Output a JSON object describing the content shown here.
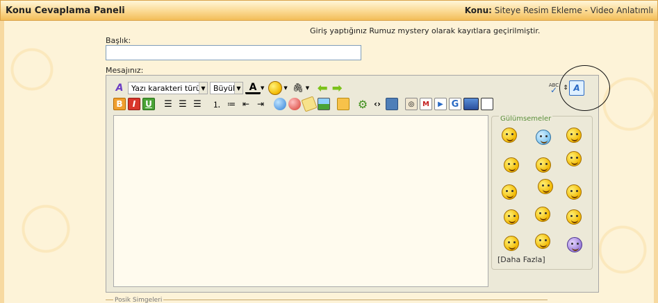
{
  "header": {
    "panel_title": "Konu Cevaplama Paneli",
    "topic_label": "Konu:",
    "topic_value": "Siteye Resim Ekleme - Video Anlatımlı"
  },
  "form": {
    "info": "Giriş yaptığınız Rumuz mystery olarak kayıtlara geçirilmiştir.",
    "title_label": "Başlık:",
    "title_value": "",
    "message_label": "Mesajınız:"
  },
  "toolbar": {
    "font_select": "Yazı karakteri türü",
    "size_select": "Büyük",
    "icons_row1": [
      "remove-format-icon",
      "font-color-icon",
      "smiley-menu-icon",
      "attachment-icon",
      "undo-icon",
      "redo-icon",
      "spellcheck-icon",
      "toggle-mode-icon"
    ],
    "icons_row2": [
      "bold-icon",
      "italic-icon",
      "underline-icon",
      "align-left-icon",
      "align-center-icon",
      "align-right-icon",
      "ordered-list-icon",
      "unordered-list-icon",
      "outdent-icon",
      "indent-icon",
      "insert-link-icon",
      "remove-link-icon",
      "email-link-icon",
      "insert-image-icon",
      "quote-icon",
      "settings-icon",
      "code-icon",
      "php-icon",
      "media-icon",
      "video-icon",
      "google-icon",
      "flag-icon",
      "box-icon"
    ],
    "spell_label": "ABC"
  },
  "smilies": {
    "legend": "Gülümsemeler",
    "more": "[Daha Fazla]",
    "grid": [
      "smile",
      "question",
      "cool-hat",
      "grin",
      "happy",
      "thumbs-cigar",
      "thumbs-up",
      "pirate",
      "rolleyes",
      "shy",
      "clap",
      "cheer",
      "wink",
      "hug",
      "sad"
    ]
  },
  "footer": {
    "label": "Posik Simgeleri"
  },
  "colors": {
    "header_orange": "#f3bd58",
    "background": "#fdf3d8",
    "editor_bg": "#ece9d8",
    "legend_green": "#5a8f3a"
  }
}
